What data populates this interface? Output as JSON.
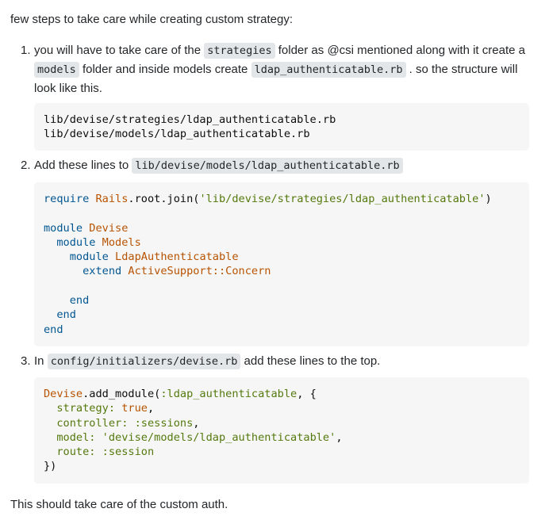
{
  "intro": "few steps to take care while creating custom strategy:",
  "steps": [
    {
      "number": "1.",
      "text_a": "you will have to take care of the ",
      "code_a": "strategies",
      "text_b": " folder as @csi mentioned along with it create a ",
      "code_b": "models",
      "text_c": " folder and inside models create ",
      "code_c": "ldap_authenticatable.rb",
      "text_d": " . so the structure will look like this.",
      "block_lines": [
        "lib/devise/strategies/ldap_authenticatable.rb",
        "lib/devise/models/ldap_authenticatable.rb"
      ]
    },
    {
      "number": "2.",
      "text_a": "Add these lines to ",
      "code_a": "lib/devise/models/ldap_authenticatable.rb",
      "code": {
        "require_kw": "require",
        "rails": "Rails",
        "root_join": ".root.join(",
        "require_path": "'lib/devise/strategies/ldap_authenticatable'",
        "close_paren": ")",
        "module_kw": "module",
        "devise": "Devise",
        "models": "Models",
        "ldap": "LdapAuthenticatable",
        "extend_kw": "extend",
        "concern": "ActiveSupport::Concern",
        "end_kw": "end"
      }
    },
    {
      "number": "3.",
      "text_a": "In ",
      "code_a": "config/initializers/devise.rb",
      "text_b": " add these lines to the top.",
      "code": {
        "devise": "Devise",
        "add_module": ".add_module(",
        "ldap_sym": ":ldap_authenticatable",
        "comma_brace": ", {",
        "strategy_key": "strategy:",
        "true_val": "true",
        "comma": ",",
        "controller_key": "controller:",
        "sessions_sym": ":sessions",
        "model_key": "model:",
        "model_path": "'devise/models/ldap_authenticatable'",
        "route_key": "route:",
        "session_sym": ":session",
        "close": "})"
      }
    }
  ],
  "outro": "This should take care of the custom auth."
}
